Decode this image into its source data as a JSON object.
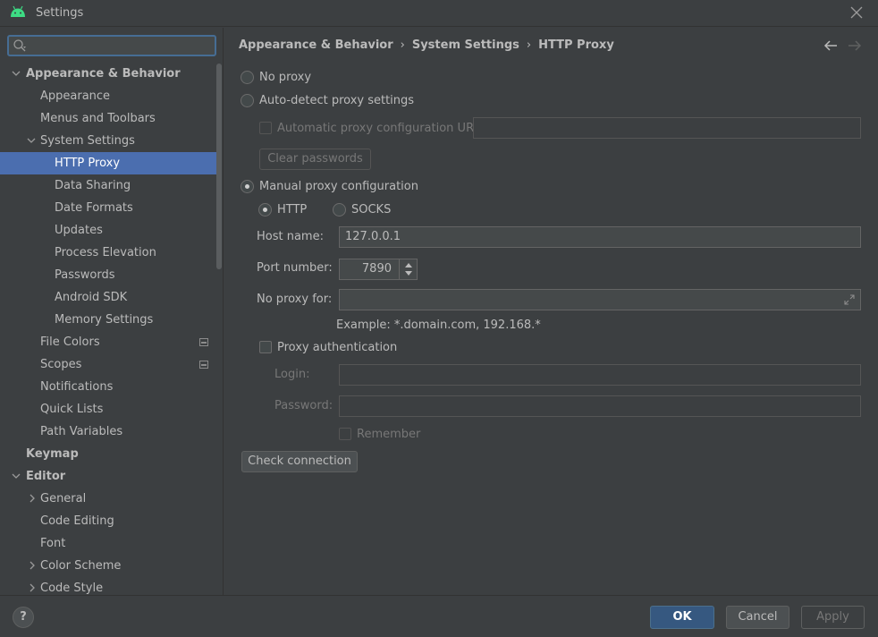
{
  "window": {
    "title": "Settings"
  },
  "sidebar": {
    "search_placeholder": "",
    "items": [
      {
        "label": "Appearance & Behavior",
        "bold": true,
        "expanded": true
      },
      {
        "label": "Appearance"
      },
      {
        "label": "Menus and Toolbars"
      },
      {
        "label": "System Settings",
        "expanded": true
      },
      {
        "label": "HTTP Proxy",
        "selected": true
      },
      {
        "label": "Data Sharing"
      },
      {
        "label": "Date Formats"
      },
      {
        "label": "Updates"
      },
      {
        "label": "Process Elevation"
      },
      {
        "label": "Passwords"
      },
      {
        "label": "Android SDK"
      },
      {
        "label": "Memory Settings"
      },
      {
        "label": "File Colors",
        "project_icon": true
      },
      {
        "label": "Scopes",
        "project_icon": true
      },
      {
        "label": "Notifications"
      },
      {
        "label": "Quick Lists"
      },
      {
        "label": "Path Variables"
      },
      {
        "label": "Keymap",
        "bold": true
      },
      {
        "label": "Editor",
        "bold": true,
        "expanded": true
      },
      {
        "label": "General",
        "collapsed": true
      },
      {
        "label": "Code Editing"
      },
      {
        "label": "Font"
      },
      {
        "label": "Color Scheme",
        "collapsed": true
      },
      {
        "label": "Code Style",
        "collapsed": true
      }
    ]
  },
  "breadcrumb": {
    "parts": [
      "Appearance & Behavior",
      "System Settings",
      "HTTP Proxy"
    ],
    "separator": "›"
  },
  "proxy": {
    "no_proxy_label": "No proxy",
    "auto_detect_label": "Auto-detect proxy settings",
    "auto_config_url_label": "Automatic proxy configuration URL:",
    "auto_config_url_value": "",
    "clear_passwords_label": "Clear passwords",
    "manual_label": "Manual proxy configuration",
    "http_label": "HTTP",
    "socks_label": "SOCKS",
    "host_label": "Host name:",
    "host_value": "127.0.0.1",
    "port_label": "Port number:",
    "port_value": "7890",
    "no_proxy_for_label": "No proxy for:",
    "no_proxy_for_value": "",
    "example_text": "Example: *.domain.com, 192.168.*",
    "proxy_auth_label": "Proxy authentication",
    "login_label": "Login:",
    "login_value": "",
    "password_label": "Password:",
    "password_value": "",
    "remember_label": "Remember",
    "check_connection_label": "Check connection",
    "selected_mode": "manual",
    "selected_protocol": "HTTP"
  },
  "footer": {
    "help_label": "?",
    "ok_label": "OK",
    "cancel_label": "Cancel",
    "apply_label": "Apply"
  },
  "colors": {
    "background": "#3c3f41",
    "selection": "#4b6eaf",
    "ok_button": "#365880",
    "android_logo": "#3ddc84"
  }
}
